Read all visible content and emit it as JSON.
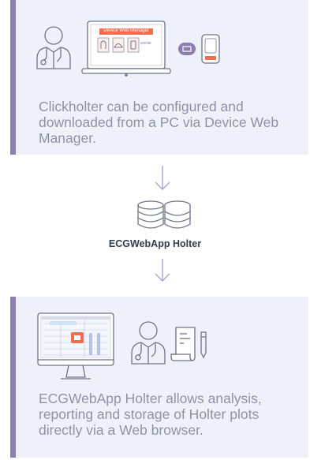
{
  "top_card": {
    "dwm_title": "Device Web Manager",
    "zoom_label": "ZOOM",
    "description": "Clickholter can be configured and downloaded from a PC via Device Web Manager."
  },
  "middle": {
    "db_label": "ECGWebApp Holter"
  },
  "bottom_card": {
    "description": "ECGWebApp Holter allows analysis, reporting and storage of Holter plots directly via a Web browser."
  },
  "colors": {
    "card_bg": "#eef1fa",
    "card_accent": "#8a7fae",
    "dwm_orange": "#f06d4d",
    "text": "#8d93a6",
    "label": "#333a4d"
  }
}
